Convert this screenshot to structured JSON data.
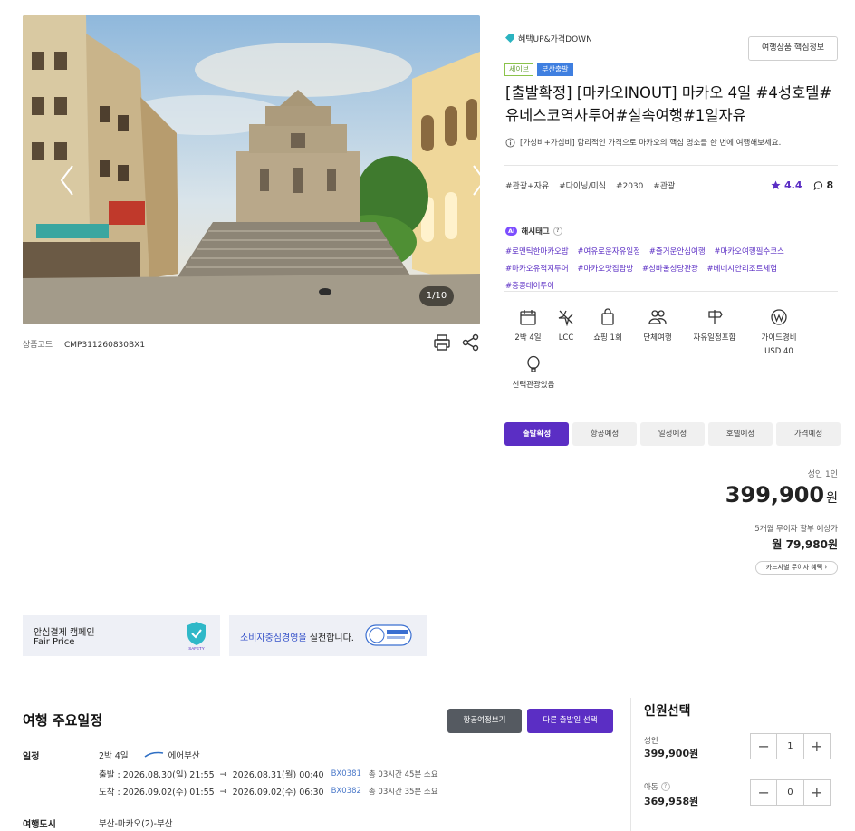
{
  "gallery": {
    "counter": "1/10"
  },
  "product": {
    "code_label": "상품코드",
    "code": "CMP311260830BX1",
    "promo": "혜택UP&가격DOWN",
    "info_button": "여행상품 핵심정보",
    "badges": [
      "세이브",
      "부산출발"
    ],
    "title": "[출발확정] [마카오INOUT] 마카오 4일 #4성호텔#유네스코역사투어#실속여행#1일자유",
    "description": "[가성비+가심비] 합리적인 가격으로 마카오의 핵심 명소를 한 번에 여행해보세요.",
    "category_tags": [
      "#관광+자유",
      "#다이닝/미식",
      "#2030",
      "#관광"
    ],
    "rating": "4.4",
    "review_count": "8",
    "hashtag_title": "해시태그",
    "ai_label": "AI",
    "hashtags": [
      "#로맨틱한마카오밤",
      "#여유로운자유일정",
      "#즐거운안심여행",
      "#마카오여행필수코스",
      "#마카오유적지투어",
      "#마카오맛집탐방",
      "#성바울성당관광",
      "#베네시안리조트체험",
      "#홍콩데이투어"
    ],
    "features": [
      {
        "icon": "calendar-icon",
        "label": "2박 4일"
      },
      {
        "icon": "airplane-icon",
        "label": "LCC"
      },
      {
        "icon": "shopping-bag-icon",
        "label": "쇼핑 1회"
      },
      {
        "icon": "group-icon",
        "label": "단체여행"
      },
      {
        "icon": "signpost-icon",
        "label": "자유일정포함"
      },
      {
        "icon": "won-icon",
        "label": "가이드경비",
        "sub": "USD 40"
      },
      {
        "icon": "balloon-icon",
        "label": "선택관광있음"
      }
    ],
    "status_tabs": [
      "출발확정",
      "항공예정",
      "일정예정",
      "호텔예정",
      "가격예정"
    ],
    "price_label": "성인 1인",
    "price": "399,900",
    "price_unit": "원",
    "installment_label": "5개월 무이자 할부 예상가",
    "installment": "월 79,980원",
    "card_button": "카드사별 무이자 혜택"
  },
  "banners": {
    "fair_title": "안심결제 캠페인",
    "fair_sub": "Fair Price",
    "ccm_highlight": "소비자중심경영을",
    "ccm_rest": " 실천합니다."
  },
  "schedule": {
    "title": "여행 주요일정",
    "flight_button": "항공여정보기",
    "other_date_button": "다른 출발일 선택",
    "period_label": "일정",
    "period": "2박 4일",
    "airline": "에어부산",
    "dep_label": "출발 : 2026.08.30(일) 21:55",
    "dep_arrive": "2026.08.31(월) 00:40",
    "dep_flight": "BX0381",
    "dep_duration": "총 03시간 45분 소요",
    "arr_label": "도착 : 2026.09.02(수) 01:55",
    "arr_arrive": "2026.09.02(수) 06:30",
    "arr_flight": "BX0382",
    "arr_duration": "총 03시간 35분 소요",
    "city_label": "여행도시",
    "city": "부산-마카오(2)-부산"
  },
  "people": {
    "title": "인원선택",
    "adult_label": "성인",
    "adult_price": "399,900원",
    "adult_count": "1",
    "child_label": "아동",
    "child_price": "369,958원",
    "child_count": "0"
  },
  "colors": {
    "accent": "#5b2ec4",
    "flight_link": "#4a78c9"
  }
}
